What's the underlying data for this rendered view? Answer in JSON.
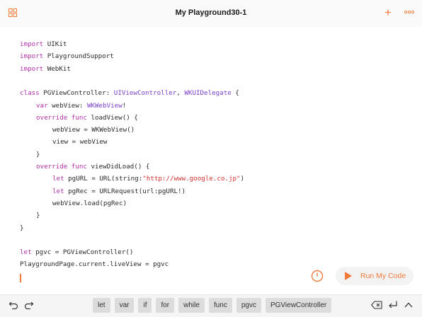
{
  "title": "My Playground30-1",
  "code_lines": [
    {
      "indent": 0,
      "tokens": [
        {
          "t": "import",
          "c": "kw"
        },
        {
          "t": " UIKit",
          "c": ""
        }
      ]
    },
    {
      "indent": 0,
      "tokens": [
        {
          "t": "import",
          "c": "kw"
        },
        {
          "t": " PlaygroundSupport",
          "c": ""
        }
      ]
    },
    {
      "indent": 0,
      "tokens": [
        {
          "t": "import",
          "c": "kw"
        },
        {
          "t": " WebKit",
          "c": ""
        }
      ]
    },
    {
      "indent": 0,
      "tokens": []
    },
    {
      "indent": 0,
      "tokens": [
        {
          "t": "class",
          "c": "kw"
        },
        {
          "t": " PGViewController: ",
          "c": ""
        },
        {
          "t": "UIViewController",
          "c": "ty"
        },
        {
          "t": ", ",
          "c": ""
        },
        {
          "t": "WKUIDelegate",
          "c": "ty"
        },
        {
          "t": " {",
          "c": ""
        }
      ]
    },
    {
      "indent": 1,
      "tokens": [
        {
          "t": "var",
          "c": "kw"
        },
        {
          "t": " webView: ",
          "c": ""
        },
        {
          "t": "WKWebView",
          "c": "ty"
        },
        {
          "t": "!",
          "c": ""
        }
      ]
    },
    {
      "indent": 1,
      "tokens": [
        {
          "t": "override func",
          "c": "kw"
        },
        {
          "t": " loadView() {",
          "c": ""
        }
      ]
    },
    {
      "indent": 2,
      "tokens": [
        {
          "t": "webView = WKWebView()",
          "c": ""
        }
      ]
    },
    {
      "indent": 2,
      "tokens": [
        {
          "t": "view = webView",
          "c": ""
        }
      ]
    },
    {
      "indent": 1,
      "tokens": [
        {
          "t": "}",
          "c": ""
        }
      ]
    },
    {
      "indent": 1,
      "tokens": [
        {
          "t": "override func",
          "c": "kw"
        },
        {
          "t": " viewDidLoad() {",
          "c": ""
        }
      ]
    },
    {
      "indent": 2,
      "tokens": [
        {
          "t": "let",
          "c": "kw"
        },
        {
          "t": " pgURL = URL(string:",
          "c": ""
        },
        {
          "t": "\"http://www.google.co.jp\"",
          "c": "st"
        },
        {
          "t": ")",
          "c": ""
        }
      ]
    },
    {
      "indent": 2,
      "tokens": [
        {
          "t": "let",
          "c": "kw"
        },
        {
          "t": " pgRec = URLRequest(url:pgURL!)",
          "c": ""
        }
      ]
    },
    {
      "indent": 2,
      "tokens": [
        {
          "t": "webView.load(pgRec)",
          "c": ""
        }
      ]
    },
    {
      "indent": 1,
      "tokens": [
        {
          "t": "}",
          "c": ""
        }
      ]
    },
    {
      "indent": 0,
      "tokens": [
        {
          "t": "}",
          "c": ""
        }
      ]
    },
    {
      "indent": 0,
      "tokens": []
    },
    {
      "indent": 0,
      "tokens": [
        {
          "t": "let",
          "c": "kw"
        },
        {
          "t": " pgvc = PGViewController()",
          "c": ""
        }
      ]
    },
    {
      "indent": 0,
      "tokens": [
        {
          "t": "PlaygroundPage.current.liveView = pgvc",
          "c": ""
        }
      ]
    }
  ],
  "run_label": "Run My Code",
  "shortcuts": [
    "let",
    "var",
    "if",
    "for",
    "while",
    "func",
    "pgvc",
    "PGViewController"
  ],
  "colors": {
    "accent": "#f07a3a",
    "keyword": "#b030a8",
    "type": "#7a3ec8",
    "string": "#d0312d"
  }
}
